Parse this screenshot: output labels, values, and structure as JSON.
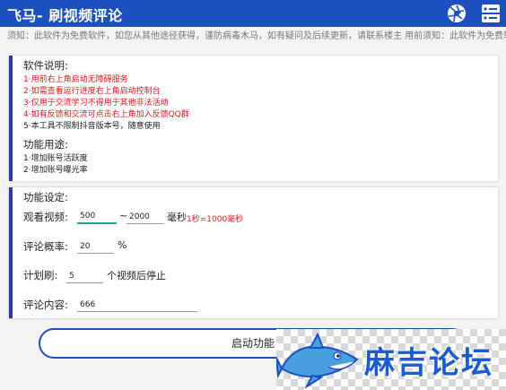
{
  "app": {
    "title": "飞马- 刷视频评论"
  },
  "header": {
    "aperture_icon": "aperture-icon",
    "console_icon": "console-icon"
  },
  "notice": {
    "text": "须知：此软件为免费软件，如您从其他途径获得，谨防病毒木马，如有疑问及后续更新，请联系楼主  用前须知：此软件为免费软件，"
  },
  "info": {
    "title": "软件说明:",
    "items": [
      "1·用前右上角启动无障碍服务",
      "2·如需查看运行进度右上角启动控制台",
      "3·仅用于交流学习不得用于其他非法活动",
      "4·如有反馈和交流可点击右上角加入反馈QQ群"
    ],
    "note": "5·本工具不限制抖音版本号，随意使用",
    "usage_title": "功能用途:",
    "usage": [
      "1·增加账号活跃度",
      "2·增加账号曝光率"
    ]
  },
  "settings": {
    "title": "功能设定:",
    "watch_label": "观看视频:",
    "watch_min": "500",
    "tilde": "~",
    "watch_max": "2000",
    "watch_unit": "毫秒",
    "watch_hint": "1秒=1000毫秒",
    "rate_label": "评论概率:",
    "rate_value": "20",
    "rate_unit": "%",
    "plan_label": "计划刷:",
    "plan_value": "5",
    "plan_suffix": "个视频后停止",
    "content_label": "评论内容:",
    "content_value": "666"
  },
  "start_button": {
    "label": "启动功能"
  },
  "watermark": {
    "text": "麻吉论坛",
    "mascot": "shark-mascot"
  },
  "colors": {
    "primary": "#1c4fbf",
    "accent_red": "#e0181c",
    "focus": "#1ba58e"
  }
}
